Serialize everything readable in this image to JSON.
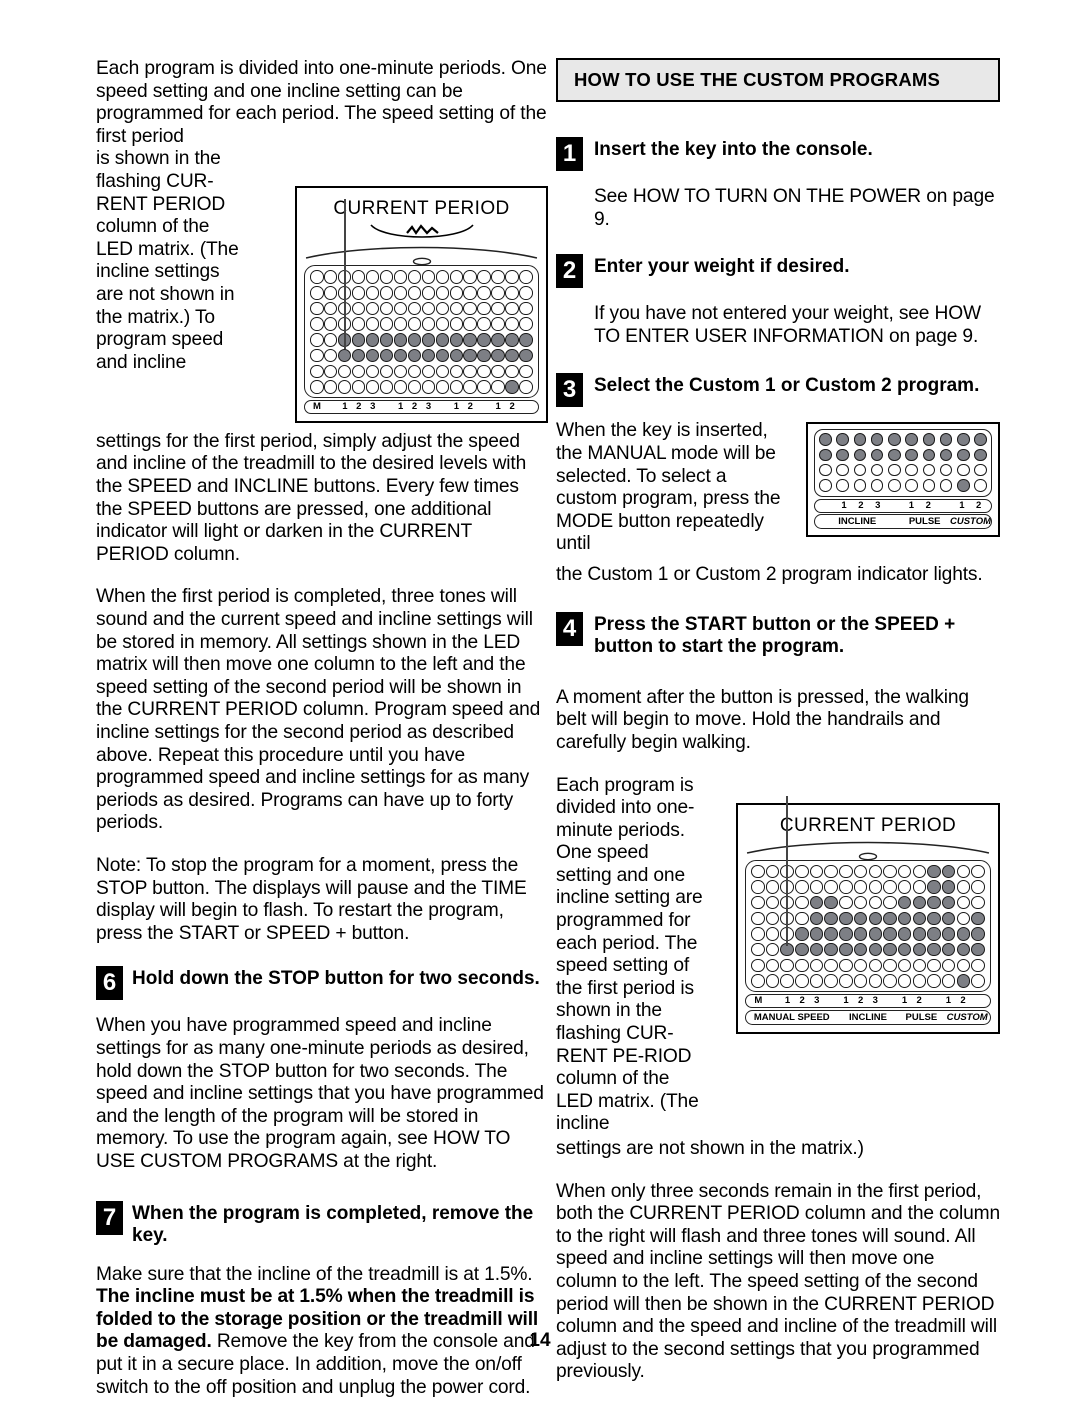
{
  "page": {
    "number": "14"
  },
  "left_column": {
    "paragraph_1_part_a": "Each program is divided into one-minute periods. One speed setting and one incline setting can be programmed for each period. The speed setting of the first period",
    "paragraph_1_part_b": "is shown in the flashing CUR-RENT PERIOD column of the LED matrix. (The incline settings are not shown in the matrix.) To program speed and incline",
    "paragraph_1_part_c": "settings for the first period, simply adjust the speed and incline of the treadmill to the desired levels with the SPEED and INCLINE buttons. Every few times the SPEED buttons are pressed, one additional indicator will light or darken in the CURRENT PERIOD column.",
    "paragraph_2": "When the first period is completed, three tones will sound and the current speed and incline settings will be stored in memory. All settings shown in the LED matrix will then move one column to the left and the speed setting of the second period will be shown in the CURRENT PERIOD column. Program speed and incline settings for the second period as described above. Repeat this procedure until you have programmed speed and incline settings for as many periods as desired. Programs can have up to forty periods.",
    "paragraph_3": "Note: To stop the program for a moment, press the STOP button. The displays will pause and the TIME display will begin to flash. To restart the program, press the START or SPEED + button.",
    "step_6": {
      "number": "6",
      "title": "Hold down the STOP button for two seconds.",
      "body": "When you have programmed speed and incline settings for as many one-minute periods as desired, hold down the STOP button for two seconds. The speed and incline settings that you have programmed and the length of the program will be stored in memory. To use the program again, see HOW TO USE CUSTOM PROGRAMS at the right."
    },
    "step_7": {
      "number": "7",
      "title": "When the program is completed, remove the key.",
      "body_plain_1": "Make sure that the incline of the treadmill is at 1.5%. ",
      "body_bold": "The incline must be at 1.5% when the treadmill is folded to the storage position or the treadmill will be damaged.",
      "body_plain_2": " Remove the key from the console and put it in a secure place. In addition, move the on/off switch to the off position and unplug the power cord."
    }
  },
  "right_column": {
    "section_title": "HOW TO USE THE CUSTOM PROGRAMS",
    "step_1": {
      "number": "1",
      "title": "Insert the key into the console.",
      "body": "See HOW TO TURN ON THE POWER on page 9."
    },
    "step_2": {
      "number": "2",
      "title": "Enter your weight if desired.",
      "body": "If you have not entered your weight, see HOW TO ENTER USER INFORMATION on page 9."
    },
    "step_3": {
      "number": "3",
      "title": "Select the Custom 1 or Custom 2 program.",
      "body_wrap": "When the key is inserted, the MANUAL mode will be selected. To select a custom program, press the MODE button repeatedly until",
      "body_after": "the Custom 1 or Custom 2 program indicator lights."
    },
    "step_4": {
      "number": "4",
      "title": "Press the START button or the SPEED + button to start the program.",
      "body_1": "A moment after the button is pressed, the walking belt will begin to move. Hold the handrails and carefully begin walking.",
      "body_2_wrap": "Each program is divided into one-minute periods. One speed setting and one incline setting are programmed for each period. The speed setting of the first period is shown in the flashing CUR-RENT PE-RIOD column of the LED matrix. (The incline",
      "body_2_after": "settings are not shown in the matrix.)",
      "body_3": "When only three seconds remain in the first period, both the CURRENT PERIOD column and the column to the right will flash and three tones will sound. All speed and incline settings will then move one column to the left. The speed setting of the second period will then be shown in the CURRENT PERIOD column and the speed and incline of the treadmill will adjust to the second settings that you programmed previously."
    }
  },
  "diagram_left": {
    "title": "CURRENT PERIOD",
    "pointer_column": 3,
    "columns": 16,
    "rows": 8,
    "lit": [
      [],
      [],
      [],
      [],
      [
        3,
        4,
        5,
        6,
        7,
        8,
        9,
        10,
        11,
        12,
        13,
        14,
        15,
        16
      ],
      [
        3,
        4,
        5,
        6,
        7,
        8,
        9,
        10,
        11,
        12,
        13,
        14,
        15,
        16
      ],
      [],
      [
        15
      ]
    ],
    "column_labels": [
      "M",
      "",
      "1",
      "2",
      "3",
      "",
      "1",
      "2",
      "3",
      "",
      "1",
      "2",
      "",
      "1",
      "2",
      ""
    ],
    "groups": []
  },
  "diagram_step3": {
    "columns": 10,
    "rows": 4,
    "lit": [
      [
        1,
        2,
        3,
        4,
        5,
        6,
        7,
        8,
        9,
        10
      ],
      [
        1,
        2,
        3,
        4,
        5,
        6,
        7,
        8,
        9,
        10
      ],
      [],
      [
        9
      ]
    ],
    "column_labels": [
      "",
      "1",
      "2",
      "3",
      "",
      "1",
      "2",
      "",
      "1",
      "2"
    ],
    "groups": [
      {
        "label": "INCLINE",
        "span": 5,
        "italic": false
      },
      {
        "label": "PULSE",
        "span": 3,
        "italic": false
      },
      {
        "label": "CUSTOM",
        "span": 2,
        "italic": true
      }
    ]
  },
  "diagram_right": {
    "title": "CURRENT PERIOD",
    "pointer_column": 3,
    "columns": 16,
    "rows": 8,
    "lit": [
      [
        13,
        14
      ],
      [
        13,
        14
      ],
      [
        5,
        6,
        11,
        12,
        13,
        14
      ],
      [
        5,
        6,
        7,
        8,
        9,
        10,
        11,
        12,
        13,
        14,
        16
      ],
      [
        4,
        5,
        6,
        7,
        8,
        9,
        10,
        11,
        12,
        13,
        14,
        15,
        16
      ],
      [
        3,
        4,
        5,
        6,
        7,
        8,
        9,
        10,
        11,
        12,
        13,
        14,
        15,
        16
      ],
      [],
      [
        15
      ]
    ],
    "column_labels": [
      "M",
      "",
      "1",
      "2",
      "3",
      "",
      "1",
      "2",
      "3",
      "",
      "1",
      "2",
      "",
      "1",
      "2",
      ""
    ],
    "groups": [
      {
        "label": "MANUAL SPEED",
        "span": 6,
        "italic": false
      },
      {
        "label": "INCLINE",
        "span": 4,
        "italic": false
      },
      {
        "label": "PULSE",
        "span": 3,
        "italic": false
      },
      {
        "label": "CUSTOM",
        "span": 3,
        "italic": true
      }
    ]
  },
  "colors": {
    "led_on": "#7d7f85",
    "led_off": "#ffffff",
    "header_bg": "#e8e8e8",
    "ink": "#000000"
  }
}
